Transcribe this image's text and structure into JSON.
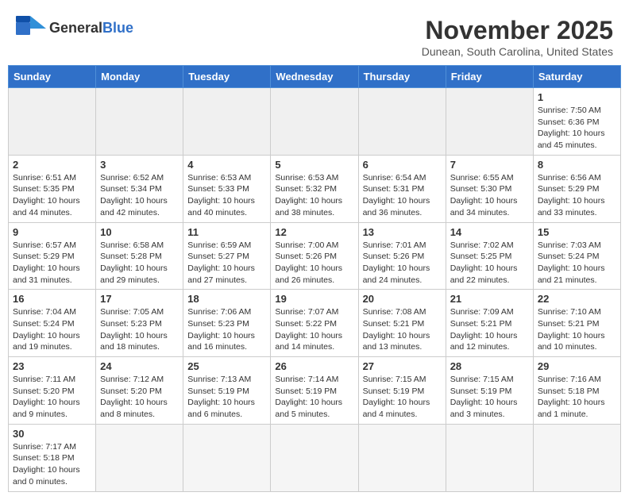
{
  "header": {
    "logo_text_regular": "General",
    "logo_text_bold": "Blue",
    "month_title": "November 2025",
    "subtitle": "Dunean, South Carolina, United States"
  },
  "weekdays": [
    "Sunday",
    "Monday",
    "Tuesday",
    "Wednesday",
    "Thursday",
    "Friday",
    "Saturday"
  ],
  "weeks": [
    [
      {
        "day": "",
        "info": "",
        "empty": true
      },
      {
        "day": "",
        "info": "",
        "empty": true
      },
      {
        "day": "",
        "info": "",
        "empty": true
      },
      {
        "day": "",
        "info": "",
        "empty": true
      },
      {
        "day": "",
        "info": "",
        "empty": true
      },
      {
        "day": "",
        "info": "",
        "empty": true
      },
      {
        "day": "1",
        "info": "Sunrise: 7:50 AM\nSunset: 6:36 PM\nDaylight: 10 hours and 45 minutes."
      }
    ],
    [
      {
        "day": "2",
        "info": "Sunrise: 6:51 AM\nSunset: 5:35 PM\nDaylight: 10 hours and 44 minutes."
      },
      {
        "day": "3",
        "info": "Sunrise: 6:52 AM\nSunset: 5:34 PM\nDaylight: 10 hours and 42 minutes."
      },
      {
        "day": "4",
        "info": "Sunrise: 6:53 AM\nSunset: 5:33 PM\nDaylight: 10 hours and 40 minutes."
      },
      {
        "day": "5",
        "info": "Sunrise: 6:53 AM\nSunset: 5:32 PM\nDaylight: 10 hours and 38 minutes."
      },
      {
        "day": "6",
        "info": "Sunrise: 6:54 AM\nSunset: 5:31 PM\nDaylight: 10 hours and 36 minutes."
      },
      {
        "day": "7",
        "info": "Sunrise: 6:55 AM\nSunset: 5:30 PM\nDaylight: 10 hours and 34 minutes."
      },
      {
        "day": "8",
        "info": "Sunrise: 6:56 AM\nSunset: 5:29 PM\nDaylight: 10 hours and 33 minutes."
      }
    ],
    [
      {
        "day": "9",
        "info": "Sunrise: 6:57 AM\nSunset: 5:29 PM\nDaylight: 10 hours and 31 minutes."
      },
      {
        "day": "10",
        "info": "Sunrise: 6:58 AM\nSunset: 5:28 PM\nDaylight: 10 hours and 29 minutes."
      },
      {
        "day": "11",
        "info": "Sunrise: 6:59 AM\nSunset: 5:27 PM\nDaylight: 10 hours and 27 minutes."
      },
      {
        "day": "12",
        "info": "Sunrise: 7:00 AM\nSunset: 5:26 PM\nDaylight: 10 hours and 26 minutes."
      },
      {
        "day": "13",
        "info": "Sunrise: 7:01 AM\nSunset: 5:26 PM\nDaylight: 10 hours and 24 minutes."
      },
      {
        "day": "14",
        "info": "Sunrise: 7:02 AM\nSunset: 5:25 PM\nDaylight: 10 hours and 22 minutes."
      },
      {
        "day": "15",
        "info": "Sunrise: 7:03 AM\nSunset: 5:24 PM\nDaylight: 10 hours and 21 minutes."
      }
    ],
    [
      {
        "day": "16",
        "info": "Sunrise: 7:04 AM\nSunset: 5:24 PM\nDaylight: 10 hours and 19 minutes."
      },
      {
        "day": "17",
        "info": "Sunrise: 7:05 AM\nSunset: 5:23 PM\nDaylight: 10 hours and 18 minutes."
      },
      {
        "day": "18",
        "info": "Sunrise: 7:06 AM\nSunset: 5:23 PM\nDaylight: 10 hours and 16 minutes."
      },
      {
        "day": "19",
        "info": "Sunrise: 7:07 AM\nSunset: 5:22 PM\nDaylight: 10 hours and 14 minutes."
      },
      {
        "day": "20",
        "info": "Sunrise: 7:08 AM\nSunset: 5:21 PM\nDaylight: 10 hours and 13 minutes."
      },
      {
        "day": "21",
        "info": "Sunrise: 7:09 AM\nSunset: 5:21 PM\nDaylight: 10 hours and 12 minutes."
      },
      {
        "day": "22",
        "info": "Sunrise: 7:10 AM\nSunset: 5:21 PM\nDaylight: 10 hours and 10 minutes."
      }
    ],
    [
      {
        "day": "23",
        "info": "Sunrise: 7:11 AM\nSunset: 5:20 PM\nDaylight: 10 hours and 9 minutes."
      },
      {
        "day": "24",
        "info": "Sunrise: 7:12 AM\nSunset: 5:20 PM\nDaylight: 10 hours and 8 minutes."
      },
      {
        "day": "25",
        "info": "Sunrise: 7:13 AM\nSunset: 5:19 PM\nDaylight: 10 hours and 6 minutes."
      },
      {
        "day": "26",
        "info": "Sunrise: 7:14 AM\nSunset: 5:19 PM\nDaylight: 10 hours and 5 minutes."
      },
      {
        "day": "27",
        "info": "Sunrise: 7:15 AM\nSunset: 5:19 PM\nDaylight: 10 hours and 4 minutes."
      },
      {
        "day": "28",
        "info": "Sunrise: 7:15 AM\nSunset: 5:19 PM\nDaylight: 10 hours and 3 minutes."
      },
      {
        "day": "29",
        "info": "Sunrise: 7:16 AM\nSunset: 5:18 PM\nDaylight: 10 hours and 1 minute."
      }
    ],
    [
      {
        "day": "30",
        "info": "Sunrise: 7:17 AM\nSunset: 5:18 PM\nDaylight: 10 hours and 0 minutes."
      },
      {
        "day": "",
        "info": "",
        "empty": true
      },
      {
        "day": "",
        "info": "",
        "empty": true
      },
      {
        "day": "",
        "info": "",
        "empty": true
      },
      {
        "day": "",
        "info": "",
        "empty": true
      },
      {
        "day": "",
        "info": "",
        "empty": true
      },
      {
        "day": "",
        "info": "",
        "empty": true
      }
    ]
  ]
}
